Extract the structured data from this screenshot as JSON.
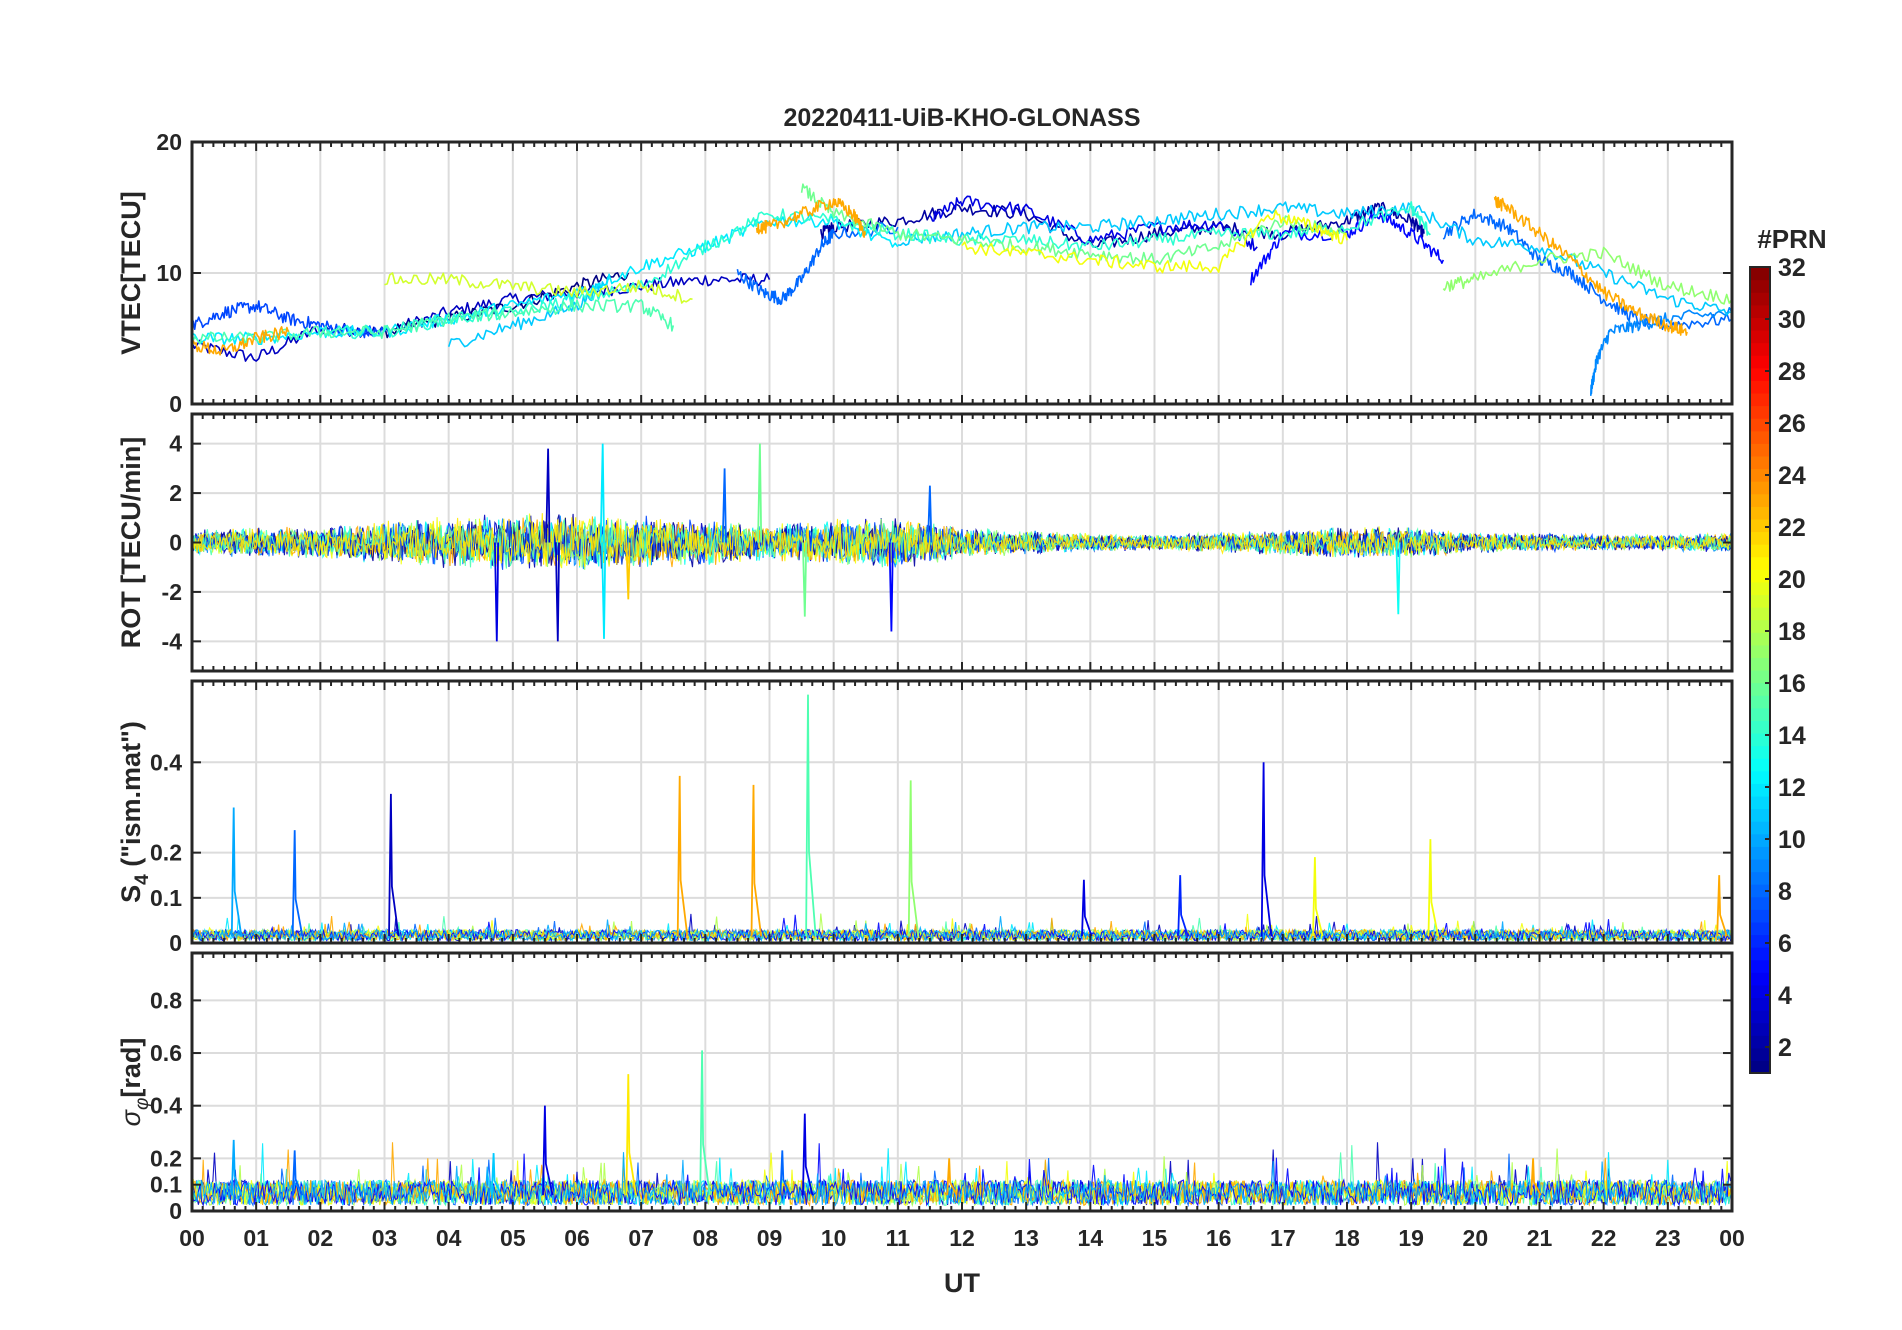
{
  "chart_data": {
    "type": "line",
    "title": "20220411-UiB-KHO-GLONASS",
    "xlabel": "UT",
    "x_tick_labels": [
      "00",
      "01",
      "02",
      "03",
      "04",
      "05",
      "06",
      "07",
      "08",
      "09",
      "10",
      "11",
      "12",
      "13",
      "14",
      "15",
      "16",
      "17",
      "18",
      "19",
      "20",
      "21",
      "22",
      "23",
      "00"
    ],
    "xlim_hours": [
      0,
      24
    ],
    "grid": true,
    "colorbar": {
      "label": "#PRN",
      "range": [
        1,
        32
      ],
      "ticks": [
        2,
        4,
        6,
        8,
        10,
        12,
        14,
        16,
        18,
        20,
        22,
        24,
        26,
        28,
        30,
        32
      ],
      "tick_labels": [
        "2",
        "4",
        "6",
        "8",
        "10",
        "12",
        "14",
        "16",
        "18",
        "20",
        "22",
        "24",
        "26",
        "28",
        "30",
        "32"
      ],
      "colormap": "jet",
      "placement": "right"
    },
    "panels": [
      {
        "id": "vtec",
        "ylabel": "VTEC[TECU]",
        "ylim": [
          0,
          20
        ],
        "yticks": [
          0,
          10,
          20
        ],
        "ytick_labels": [
          "0",
          "10",
          "20"
        ],
        "series": [
          {
            "prn": 3,
            "x": [
              0,
              1,
              2,
              3,
              4,
              5,
              6,
              7,
              8,
              9
            ],
            "y": [
              4.5,
              3.5,
              5.8,
              5.5,
              7,
              8,
              8.5,
              9,
              9.5,
              9.5
            ]
          },
          {
            "prn": 1,
            "x": [
              3,
              4,
              5,
              6,
              6.8
            ],
            "y": [
              5.5,
              6.5,
              7.5,
              9,
              10
            ]
          },
          {
            "prn": 2,
            "x": [
              9.8,
              10,
              11,
              12,
              13,
              14,
              15,
              16,
              17,
              18,
              18.5,
              19,
              19.2
            ],
            "y": [
              13,
              13.5,
              14,
              15,
              14.5,
              12,
              13,
              13.5,
              13,
              14,
              15,
              14,
              13
            ]
          },
          {
            "prn": 4,
            "x": [
              11.5,
              12,
              13,
              14,
              15,
              16,
              16.6
            ],
            "y": [
              14,
              15.5,
              14.8,
              12.5,
              13.5,
              13.8,
              12
            ]
          },
          {
            "prn": 5,
            "x": [
              16.5,
              17,
              18,
              18.5,
              19,
              19.5
            ],
            "y": [
              9.5,
              13,
              13,
              14.5,
              13,
              11
            ]
          },
          {
            "prn": 7,
            "x": [
              0,
              0.5,
              1,
              1.5,
              2,
              2.5,
              3
            ],
            "y": [
              6,
              7,
              7.5,
              6.5,
              6,
              5.5,
              5.5
            ]
          },
          {
            "prn": 8,
            "x": [
              8.5,
              8.9,
              9.2,
              9.5,
              9.8,
              10,
              11
            ],
            "y": [
              10,
              8.5,
              8,
              9.5,
              12,
              13,
              13.5
            ]
          },
          {
            "prn": 8,
            "x": [
              19.5,
              20,
              20.5,
              21,
              21.5,
              22,
              22.5,
              23,
              24
            ],
            "y": [
              13,
              14.5,
              13.5,
              11,
              10,
              8,
              6.5,
              6,
              6.5
            ]
          },
          {
            "prn": 9,
            "x": [
              21.8,
              21.9,
              22.1,
              22.5,
              23,
              24
            ],
            "y": [
              1,
              3.5,
              5.5,
              6,
              6.5,
              7
            ]
          },
          {
            "prn": 11,
            "x": [
              4,
              5,
              6,
              6.5
            ],
            "y": [
              4.5,
              6,
              7.5,
              9.5
            ]
          },
          {
            "prn": 11,
            "x": [
              11,
              12,
              13,
              14,
              15,
              16,
              17,
              18,
              19,
              20,
              21,
              22,
              23,
              24
            ],
            "y": [
              12.5,
              13,
              13.5,
              13.5,
              14,
              14.5,
              15,
              14.5,
              15,
              12.5,
              12,
              10,
              8,
              7
            ]
          },
          {
            "prn": 12,
            "x": [
              0,
              1,
              2,
              3,
              4,
              5,
              6,
              7,
              8,
              9,
              10,
              11
            ],
            "y": [
              5,
              5,
              5.5,
              5.5,
              6.5,
              7.5,
              8.5,
              10.5,
              12,
              14,
              14,
              12
            ]
          },
          {
            "prn": 14,
            "x": [
              2,
              3,
              4,
              5,
              6,
              7,
              8,
              9,
              10,
              11,
              12,
              13,
              14,
              15,
              16,
              17,
              18,
              19,
              19.3
            ],
            "y": [
              5.5,
              5.5,
              6.5,
              7,
              8,
              9,
              12,
              14.5,
              14,
              13,
              12.5,
              12.5,
              12,
              12.5,
              13,
              13,
              13.5,
              15,
              13
            ]
          },
          {
            "prn": 15,
            "x": [
              0,
              1,
              2,
              3,
              4,
              5,
              6,
              7,
              7.5
            ],
            "y": [
              5,
              5,
              5.5,
              5.5,
              6.5,
              7,
              7.5,
              7.5,
              6
            ]
          },
          {
            "prn": 16,
            "x": [
              9.5,
              10,
              11,
              12,
              13,
              14,
              15,
              16,
              17,
              18
            ],
            "y": [
              16.5,
              14.5,
              13,
              12.5,
              12,
              11.5,
              11,
              12,
              14,
              13
            ]
          },
          {
            "prn": 17,
            "x": [
              19.5,
              20,
              21,
              22,
              23,
              24
            ],
            "y": [
              9,
              9.5,
              11,
              11.5,
              9,
              8
            ]
          },
          {
            "prn": 19,
            "x": [
              3,
              4,
              5,
              6,
              7,
              7.8
            ],
            "y": [
              9.5,
              9.5,
              9,
              8.5,
              9,
              8
            ]
          },
          {
            "prn": 20,
            "x": [
              12,
              13,
              14,
              15,
              16,
              16.8,
              17.5,
              18
            ],
            "y": [
              12,
              11.5,
              11,
              10.5,
              10.5,
              14.5,
              13.5,
              12.5
            ]
          },
          {
            "prn": 23,
            "x": [
              0,
              0.5,
              1,
              1.5
            ],
            "y": [
              4.5,
              4,
              5,
              5.5
            ]
          },
          {
            "prn": 23,
            "x": [
              8.8,
              9,
              9.5,
              10,
              10.3,
              10.5
            ],
            "y": [
              13.5,
              13.5,
              14.5,
              15.5,
              14.5,
              13
            ]
          },
          {
            "prn": 23,
            "x": [
              20.3,
              20.5,
              21,
              21.5,
              22,
              22.5,
              23,
              23.3
            ],
            "y": [
              15.5,
              15,
              13,
              11,
              8.5,
              7,
              6,
              5.5
            ]
          }
        ]
      },
      {
        "id": "rot",
        "ylabel": "ROT [TECU/min]",
        "ylim": [
          -5.2,
          5.2
        ],
        "yticks": [
          -4,
          -2,
          0,
          2,
          4
        ],
        "ytick_labels": [
          "-4",
          "-2",
          "0",
          "2",
          "4"
        ],
        "noise_envelope": {
          "hours": [
            0,
            1,
            2,
            3,
            4,
            5,
            6,
            7,
            8,
            9,
            10,
            11,
            12,
            13,
            14,
            15,
            16,
            17,
            18,
            19,
            20,
            21,
            22,
            23,
            24
          ],
          "amplitude": [
            0.5,
            0.6,
            0.6,
            0.8,
            1.0,
            1.1,
            1.1,
            1.0,
            0.9,
            0.7,
            0.9,
            1.0,
            0.6,
            0.45,
            0.35,
            0.3,
            0.4,
            0.5,
            0.6,
            0.6,
            0.4,
            0.35,
            0.3,
            0.3,
            0.4
          ]
        },
        "spikes": [
          {
            "prn": 4,
            "x": 4.75,
            "y": -4.0
          },
          {
            "prn": 3,
            "x": 5.55,
            "y": 3.8
          },
          {
            "prn": 3,
            "x": 5.7,
            "y": -4.0
          },
          {
            "prn": 12,
            "x": 6.4,
            "y": 4.0
          },
          {
            "prn": 12,
            "x": 6.42,
            "y": -3.9
          },
          {
            "prn": 22,
            "x": 6.8,
            "y": -2.3
          },
          {
            "prn": 16,
            "x": 8.85,
            "y": 4.0
          },
          {
            "prn": 8,
            "x": 8.3,
            "y": 3.0
          },
          {
            "prn": 16,
            "x": 9.55,
            "y": -3.0
          },
          {
            "prn": 5,
            "x": 10.9,
            "y": -3.6
          },
          {
            "prn": 8,
            "x": 11.5,
            "y": 2.3
          },
          {
            "prn": 13,
            "x": 18.8,
            "y": -2.9
          }
        ]
      },
      {
        "id": "s4",
        "ylabel": "S4 (\"ism.mat\")",
        "ylabel_main": "S",
        "ylabel_sub": "4",
        "ylabel_rest": " (\"ism.mat\")",
        "ylim": [
          0,
          0.58
        ],
        "yticks": [
          0,
          0.1,
          0.2,
          0.4
        ],
        "ytick_labels": [
          "0",
          "0.1",
          "0.2",
          "0.4"
        ],
        "noise_baseline": 0.015,
        "spikes": [
          {
            "prn": 10,
            "x": 0.65,
            "y": 0.3
          },
          {
            "prn": 8,
            "x": 1.6,
            "y": 0.25
          },
          {
            "prn": 3,
            "x": 3.1,
            "y": 0.33
          },
          {
            "prn": 23,
            "x": 7.6,
            "y": 0.37
          },
          {
            "prn": 23,
            "x": 8.75,
            "y": 0.35
          },
          {
            "prn": 15,
            "x": 9.6,
            "y": 0.55
          },
          {
            "prn": 17,
            "x": 11.2,
            "y": 0.36
          },
          {
            "prn": 4,
            "x": 16.7,
            "y": 0.4
          },
          {
            "prn": 20,
            "x": 17.5,
            "y": 0.19
          },
          {
            "prn": 20,
            "x": 19.3,
            "y": 0.23
          },
          {
            "prn": 23,
            "x": 23.8,
            "y": 0.15
          },
          {
            "prn": 4,
            "x": 13.9,
            "y": 0.14
          },
          {
            "prn": 6,
            "x": 15.4,
            "y": 0.15
          }
        ]
      },
      {
        "id": "sigma_phi",
        "ylabel": "σφ[rad]",
        "ylabel_main": "σ",
        "ylabel_sub": "φ",
        "ylabel_rest": "[rad]",
        "ylim": [
          0,
          0.98
        ],
        "yticks": [
          0,
          0.1,
          0.2,
          0.4,
          0.6,
          0.8
        ],
        "ytick_labels": [
          "0",
          "0.1",
          "0.2",
          "0.4",
          "0.6",
          "0.8"
        ],
        "noise_baseline": 0.06,
        "spikes": [
          {
            "prn": 10,
            "x": 0.65,
            "y": 0.27
          },
          {
            "prn": 8,
            "x": 1.6,
            "y": 0.23
          },
          {
            "prn": 4,
            "x": 5.5,
            "y": 0.4
          },
          {
            "prn": 11,
            "x": 4.7,
            "y": 0.22
          },
          {
            "prn": 21,
            "x": 6.8,
            "y": 0.52
          },
          {
            "prn": 15,
            "x": 7.95,
            "y": 0.61
          },
          {
            "prn": 4,
            "x": 9.55,
            "y": 0.37
          },
          {
            "prn": 8,
            "x": 9.2,
            "y": 0.23
          },
          {
            "prn": 23,
            "x": 11.8,
            "y": 0.2
          },
          {
            "prn": 23,
            "x": 20.9,
            "y": 0.2
          }
        ]
      }
    ]
  }
}
